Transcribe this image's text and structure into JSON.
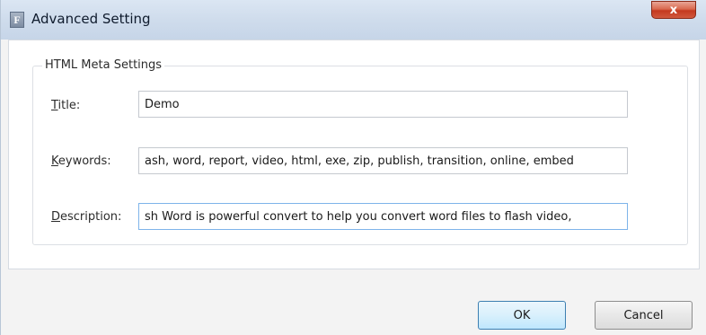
{
  "window": {
    "title": "Advanced Setting",
    "app_icon_letter": "F",
    "close_glyph": "x"
  },
  "group": {
    "label": "HTML Meta Settings"
  },
  "fields": {
    "title": {
      "label_accel": "T",
      "label_rest": "itle:",
      "value": "Demo"
    },
    "keywords": {
      "label_accel": "K",
      "label_rest": "eywords:",
      "value": "ash, word, report, video, html, exe, zip, publish, transition, online, embed"
    },
    "description": {
      "label_accel": "D",
      "label_rest": "escription:",
      "value": "sh Word is powerful convert to help you convert word files to flash video,"
    }
  },
  "buttons": {
    "ok": "OK",
    "cancel": "Cancel"
  },
  "colors": {
    "titlebar": "#cfdcec",
    "close_button": "#c4391f",
    "focus_border": "#7eb4ea"
  }
}
